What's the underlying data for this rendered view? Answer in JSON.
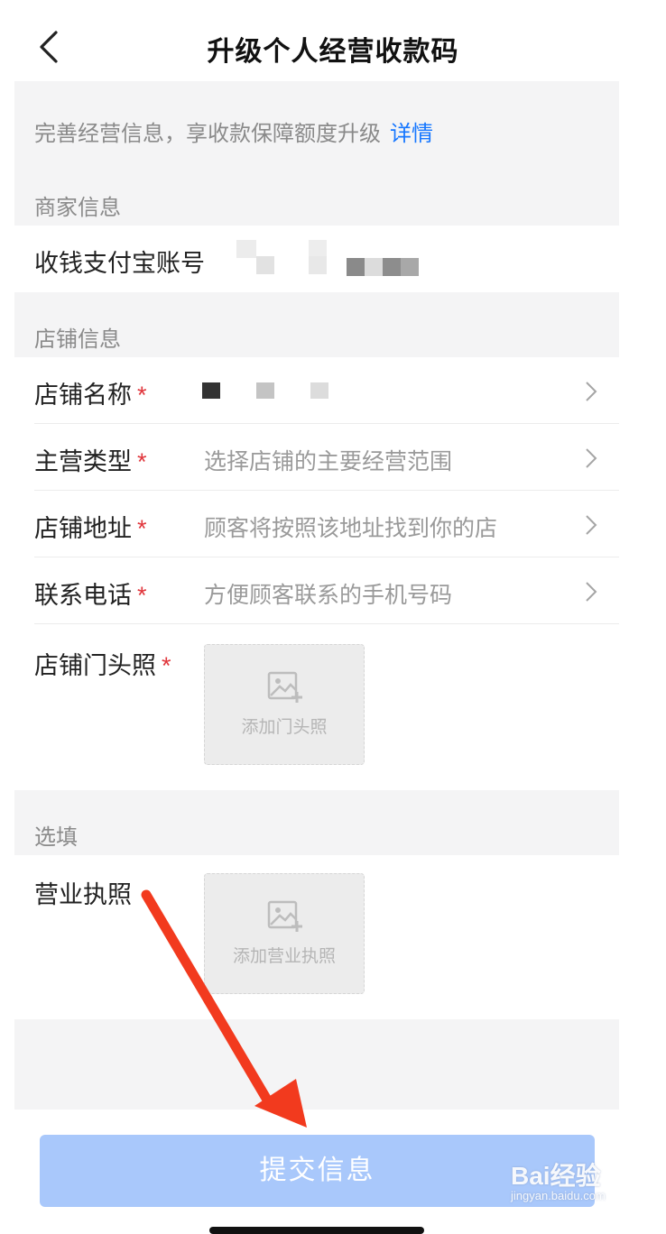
{
  "header": {
    "title": "升级个人经营收款码"
  },
  "banner": {
    "text": "完善经营信息，享收款保障额度升级",
    "link": "详情"
  },
  "merchant_section": {
    "title": "商家信息",
    "account_label": "收钱支付宝账号"
  },
  "store_section": {
    "title": "店铺信息",
    "rows": [
      {
        "label": "店铺名称",
        "required_mark": "*",
        "placeholder": ""
      },
      {
        "label": "主营类型",
        "required_mark": "*",
        "placeholder": "选择店铺的主要经营范围"
      },
      {
        "label": "店铺地址",
        "required_mark": "*",
        "placeholder": "顾客将按照该地址找到你的店"
      },
      {
        "label": "联系电话",
        "required_mark": "*",
        "placeholder": "方便顾客联系的手机号码"
      }
    ],
    "photo": {
      "label": "店铺门头照",
      "required_mark": "*",
      "upload_text": "添加门头照"
    }
  },
  "optional_section": {
    "title": "选填",
    "license": {
      "label": "营业执照",
      "upload_text": "添加营业执照"
    }
  },
  "submit": {
    "label": "提交信息"
  },
  "watermark": {
    "brand": "Bai经验",
    "url": "jingyan.baidu.com"
  },
  "colors": {
    "accent": "#1677ff",
    "required": "#e0353b",
    "submit_bg": "#a9c8fb",
    "arrow": "#f23a1e"
  }
}
